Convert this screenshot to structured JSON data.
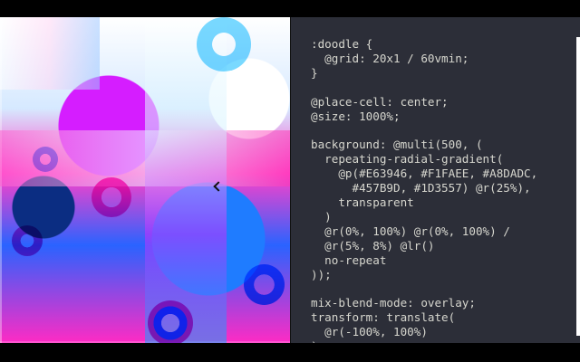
{
  "preview": {
    "cursor_name": "cursor-pointer",
    "palette": [
      "#E63946",
      "#F1FAEE",
      "#A8DADC",
      "#457B9D",
      "#1D3557"
    ]
  },
  "code": {
    "lines": [
      ":doodle {",
      "  @grid: 20x1 / 60vmin;",
      "}",
      "",
      "@place-cell: center;",
      "@size: 1000%;",
      "",
      "background: @multi(500, (",
      "  repeating-radial-gradient(",
      "    @p(#E63946, #F1FAEE, #A8DADC,",
      "      #457B9D, #1D3557) @r(25%),",
      "    transparent",
      "  )",
      "  @r(0%, 100%) @r(0%, 100%) /",
      "  @r(5%, 8%) @lr()",
      "  no-repeat",
      "));",
      "",
      "mix-blend-mode: overlay;",
      "transform: translate(",
      "  @r(-100%, 100%)",
      ");"
    ]
  }
}
